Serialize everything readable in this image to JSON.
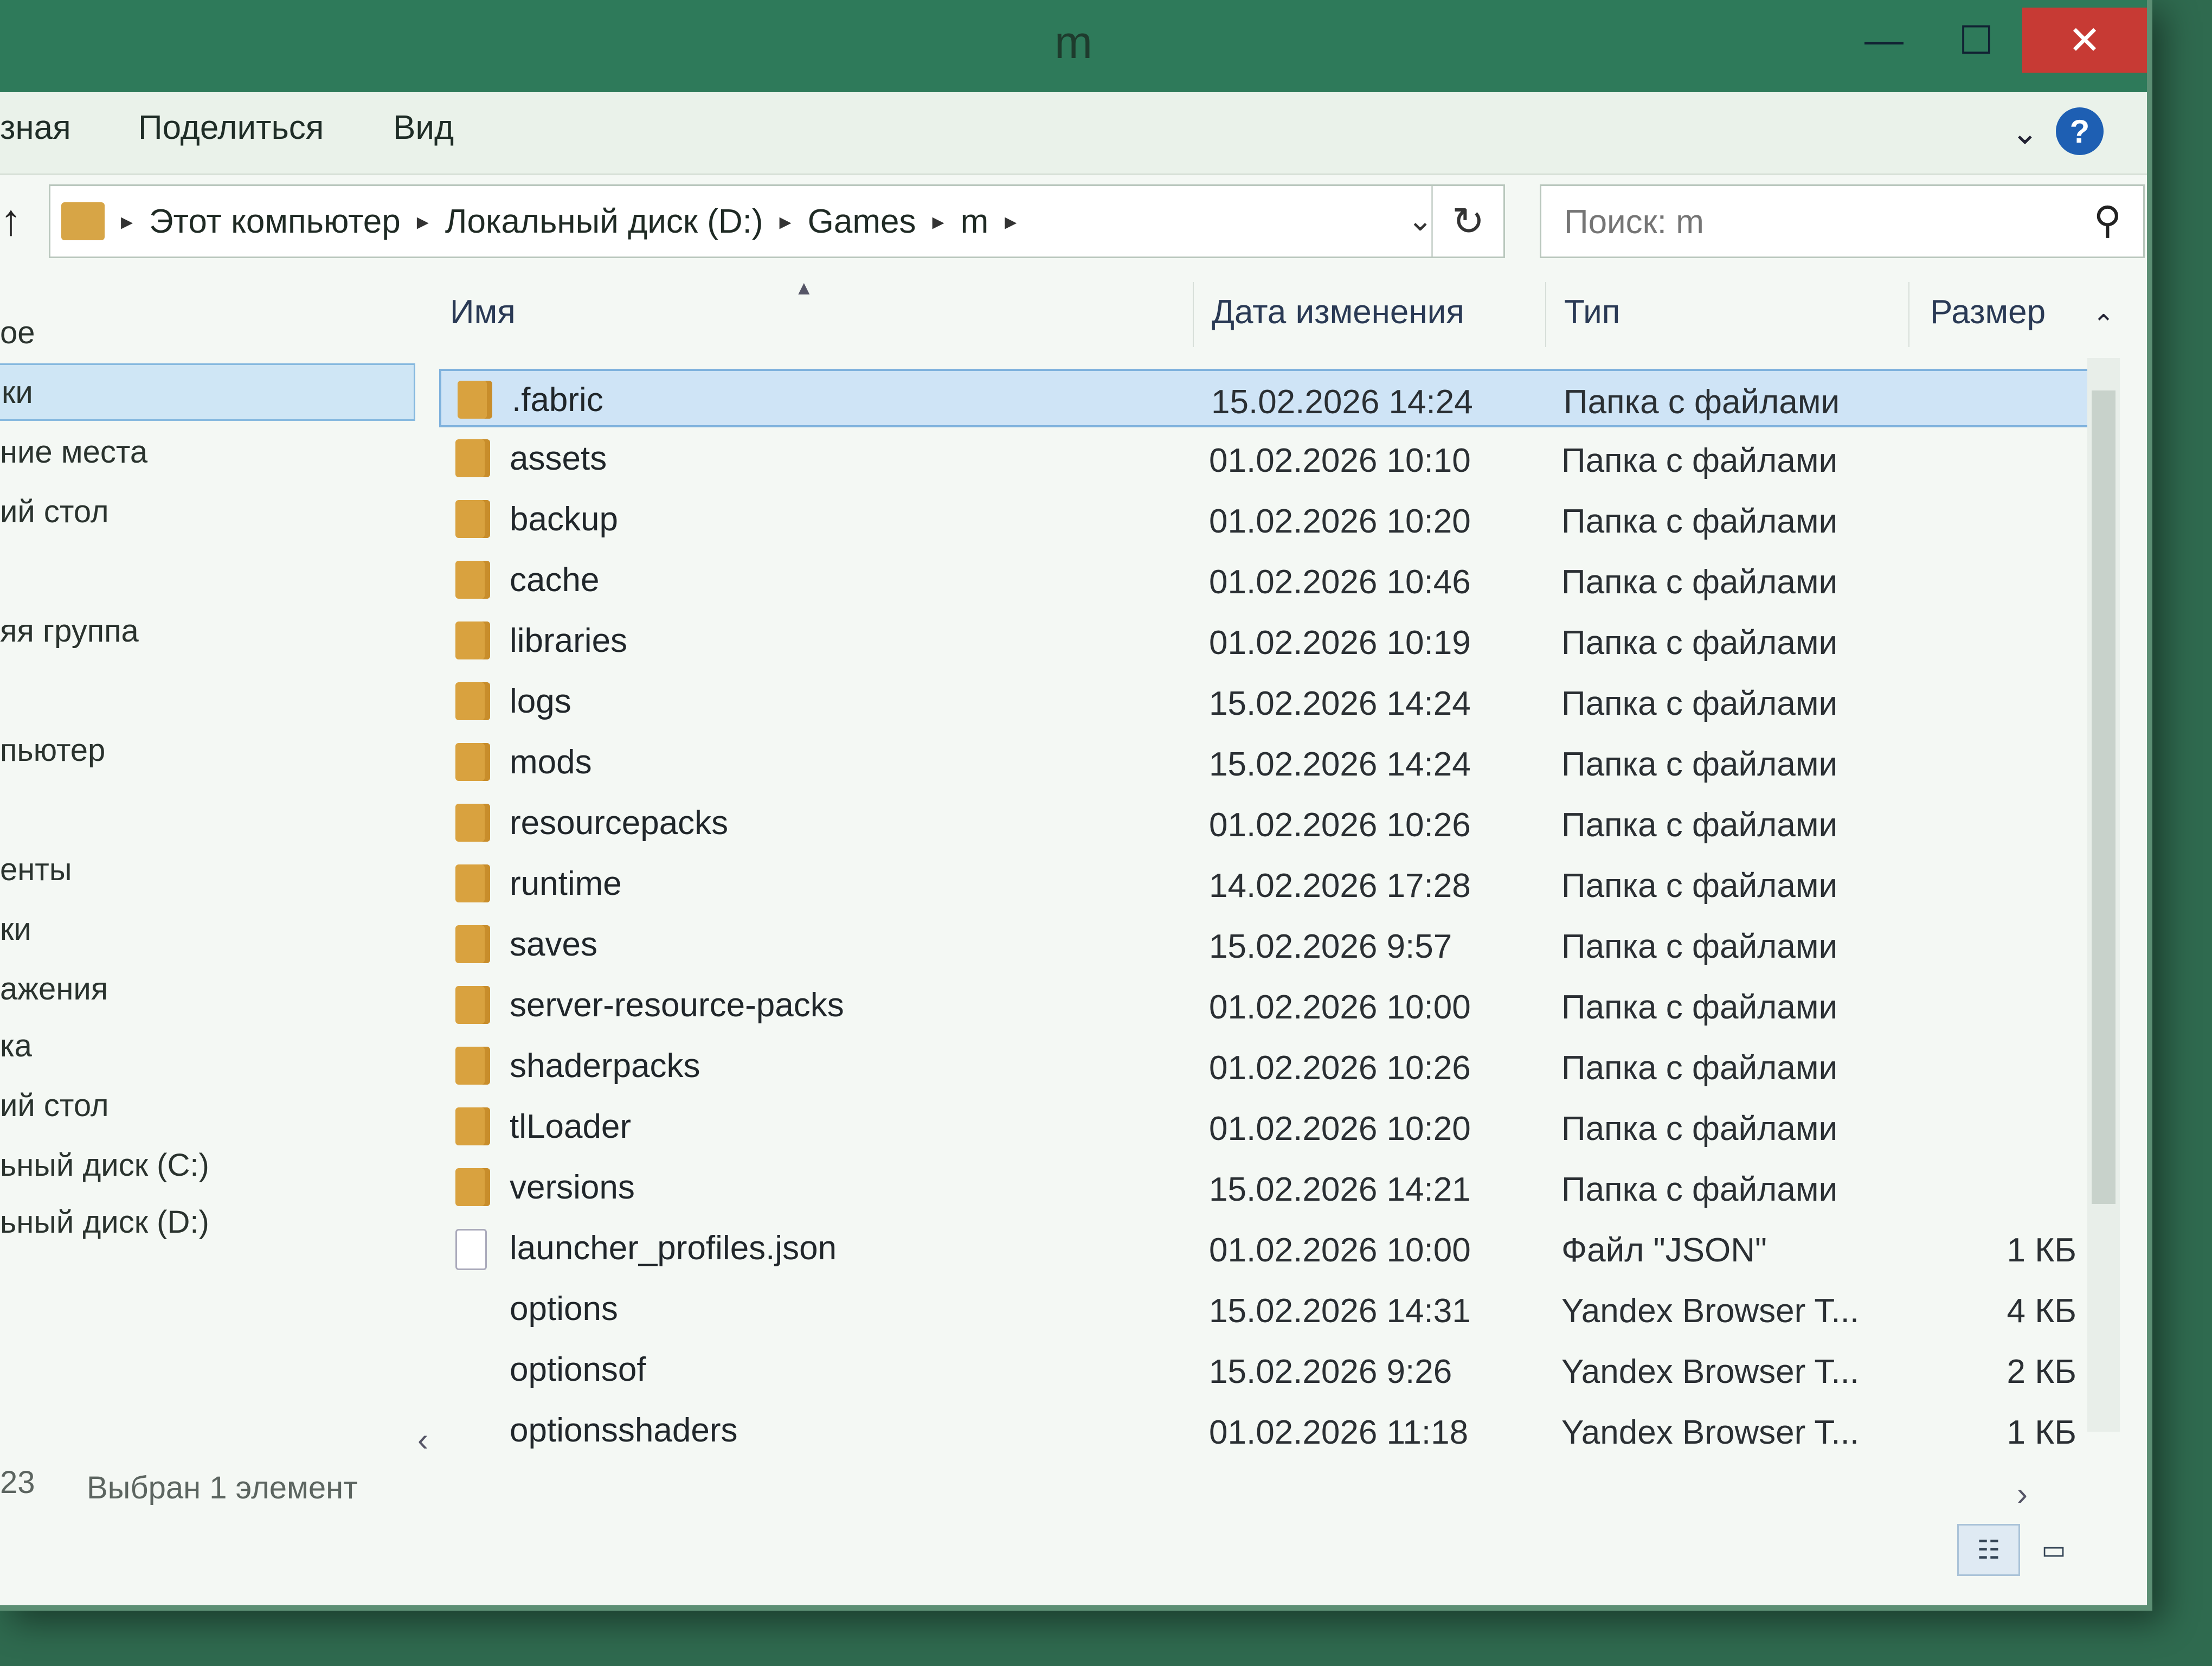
{
  "window": {
    "title": "m"
  },
  "titlebar": {
    "minimize": "—",
    "maximize": "☐",
    "close": "✕"
  },
  "ribbon": {
    "tabs": [
      "зная",
      "Поделиться",
      "Вид"
    ],
    "expand": "⌄",
    "help": "?"
  },
  "address": {
    "up": "↑",
    "breadcrumbs": [
      "Этот компьютер",
      "Локальный диск (D:)",
      "Games",
      "m"
    ],
    "separator": "▸",
    "dropdown": "⌄",
    "refresh": "↻"
  },
  "search": {
    "placeholder": "Поиск: m",
    "icon": "⚲"
  },
  "nav": {
    "items": [
      {
        "label": "ое",
        "selected": false
      },
      {
        "label": "ки",
        "selected": true
      },
      {
        "label": "ние места",
        "selected": false
      },
      {
        "label": "ий стол",
        "selected": false
      },
      {
        "label": "яя группа",
        "selected": false
      },
      {
        "label": "пьютер",
        "selected": false
      },
      {
        "label": "енты",
        "selected": false
      },
      {
        "label": "ки",
        "selected": false
      },
      {
        "label": "ажения",
        "selected": false
      },
      {
        "label": "ка",
        "selected": false
      },
      {
        "label": "ий стол",
        "selected": false
      },
      {
        "label": "ьный диск (C:)",
        "selected": false
      },
      {
        "label": "ьный диск (D:)",
        "selected": false
      }
    ]
  },
  "columns": {
    "name": "Имя",
    "date": "Дата изменения",
    "type": "Тип",
    "size": "Размер",
    "sort_caret": "▲"
  },
  "files": [
    {
      "name": ".fabric",
      "date": "15.02.2026 14:24",
      "type": "Папка с файлами",
      "size": "",
      "icon": "folder",
      "selected": true
    },
    {
      "name": "assets",
      "date": "01.02.2026 10:10",
      "type": "Папка с файлами",
      "size": "",
      "icon": "folder",
      "selected": false
    },
    {
      "name": "backup",
      "date": "01.02.2026 10:20",
      "type": "Папка с файлами",
      "size": "",
      "icon": "folder",
      "selected": false
    },
    {
      "name": "cache",
      "date": "01.02.2026 10:46",
      "type": "Папка с файлами",
      "size": "",
      "icon": "folder",
      "selected": false
    },
    {
      "name": "libraries",
      "date": "01.02.2026 10:19",
      "type": "Папка с файлами",
      "size": "",
      "icon": "folder",
      "selected": false
    },
    {
      "name": "logs",
      "date": "15.02.2026 14:24",
      "type": "Папка с файлами",
      "size": "",
      "icon": "folder",
      "selected": false
    },
    {
      "name": "mods",
      "date": "15.02.2026 14:24",
      "type": "Папка с файлами",
      "size": "",
      "icon": "folder",
      "selected": false
    },
    {
      "name": "resourcepacks",
      "date": "01.02.2026 10:26",
      "type": "Папка с файлами",
      "size": "",
      "icon": "folder",
      "selected": false
    },
    {
      "name": "runtime",
      "date": "14.02.2026 17:28",
      "type": "Папка с файлами",
      "size": "",
      "icon": "folder",
      "selected": false
    },
    {
      "name": "saves",
      "date": "15.02.2026 9:57",
      "type": "Папка с файлами",
      "size": "",
      "icon": "folder",
      "selected": false
    },
    {
      "name": "server-resource-packs",
      "date": "01.02.2026 10:00",
      "type": "Папка с файлами",
      "size": "",
      "icon": "folder",
      "selected": false
    },
    {
      "name": "shaderpacks",
      "date": "01.02.2026 10:26",
      "type": "Папка с файлами",
      "size": "",
      "icon": "folder",
      "selected": false
    },
    {
      "name": "tlLoader",
      "date": "01.02.2026 10:20",
      "type": "Папка с файлами",
      "size": "",
      "icon": "folder",
      "selected": false
    },
    {
      "name": "versions",
      "date": "15.02.2026 14:21",
      "type": "Папка с файлами",
      "size": "",
      "icon": "folder",
      "selected": false
    },
    {
      "name": "launcher_profiles.json",
      "date": "01.02.2026 10:00",
      "type": "Файл \"JSON\"",
      "size": "1 КБ",
      "icon": "file",
      "selected": false
    },
    {
      "name": "options",
      "date": "15.02.2026 14:31",
      "type": "Yandex Browser T...",
      "size": "4 КБ",
      "icon": "blank",
      "selected": false
    },
    {
      "name": "optionsof",
      "date": "15.02.2026 9:26",
      "type": "Yandex Browser T...",
      "size": "2 КБ",
      "icon": "blank",
      "selected": false
    },
    {
      "name": "optionsshaders",
      "date": "01.02.2026 11:18",
      "type": "Yandex Browser T...",
      "size": "1 КБ",
      "icon": "blank",
      "selected": false
    }
  ],
  "status": {
    "count": "23",
    "selected": "Выбран 1 элемент"
  },
  "view_buttons": {
    "details": "☷",
    "tiles": "▭"
  },
  "scroll": {
    "up": "⌃",
    "left": "‹",
    "right": "›"
  },
  "colors": {
    "selection": "#cfe4f6",
    "folder": "#d9a23f",
    "close": "#c73a34",
    "help": "#1e5fb3"
  }
}
